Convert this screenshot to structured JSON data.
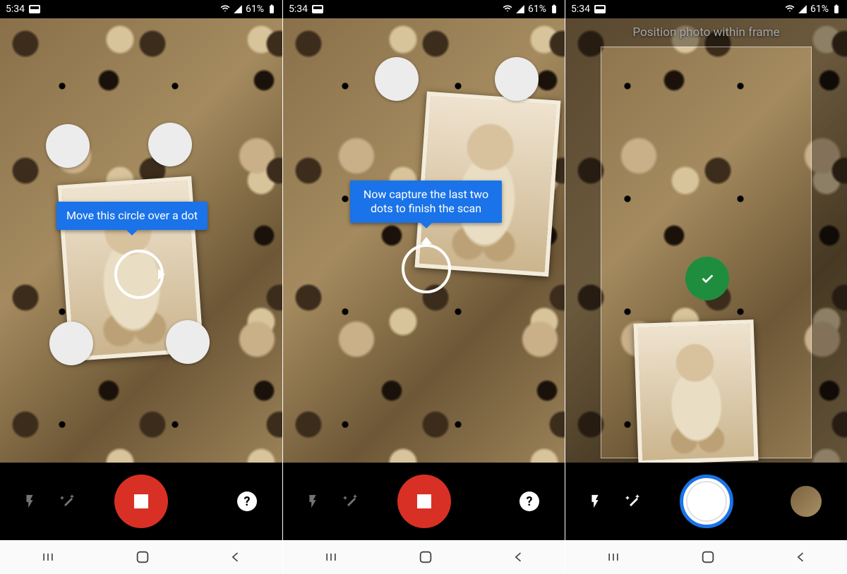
{
  "status": {
    "time": "5:34",
    "battery": "61%",
    "mail_icon": "mail-icon",
    "wifi_icon": "wifi-icon",
    "signal_icon": "signal-icon",
    "battery_icon": "battery-icon"
  },
  "screen1": {
    "tooltip": "Move this circle over a dot",
    "dots_remaining": 4,
    "controls": {
      "flash": "flash-icon",
      "wand": "magic-wand-icon",
      "shutter_mode": "stop",
      "help": "?"
    }
  },
  "screen2": {
    "tooltip": "Now capture the last two\ndots to finish the scan",
    "dots_remaining": 2,
    "controls": {
      "flash": "flash-icon",
      "wand": "magic-wand-icon",
      "shutter_mode": "stop",
      "help": "?"
    }
  },
  "screen3": {
    "instruction": "Position photo within frame",
    "check_state": "done",
    "controls": {
      "flash": "flash-icon",
      "wand": "magic-wand-icon",
      "shutter_mode": "capture",
      "thumbnail": "recent-scan-thumbnail"
    }
  },
  "nav": {
    "recents": "recents-button",
    "home": "home-button",
    "back": "back-button"
  }
}
